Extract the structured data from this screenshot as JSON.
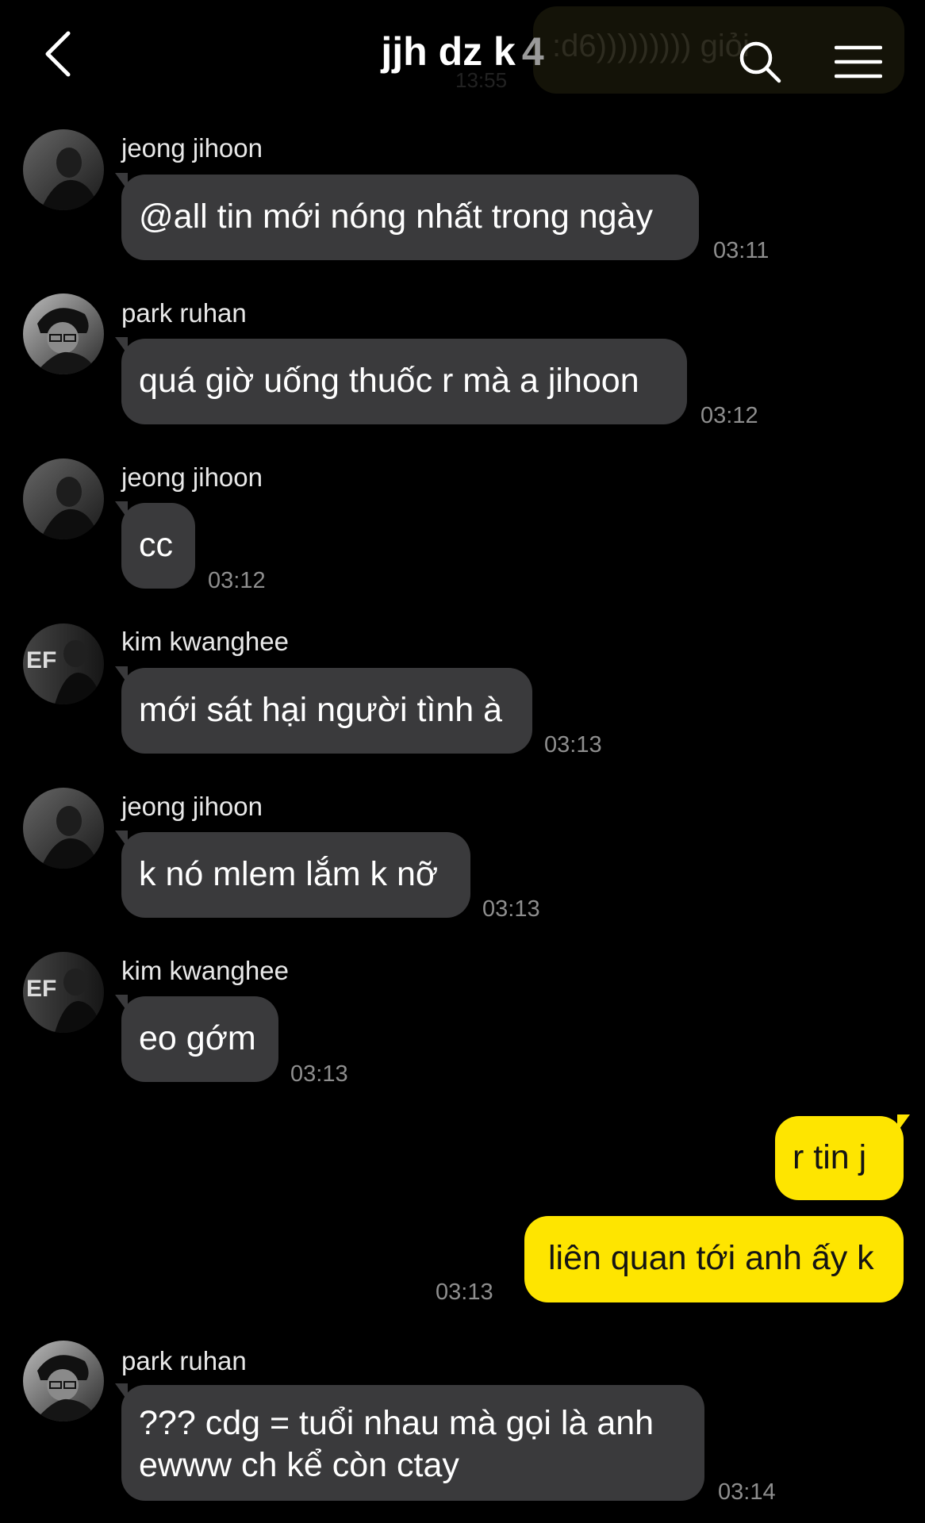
{
  "header": {
    "title": "jjh dz k",
    "member_count": "4",
    "icons": {
      "back": "back-arrow-icon",
      "search": "search-icon",
      "menu": "hamburger-menu-icon"
    },
    "behind_message": {
      "text": ":d6))))))))) giỏi",
      "time": "13:55"
    }
  },
  "colors": {
    "background": "#000000",
    "incoming_bubble": "#3a3a3c",
    "outgoing_bubble": "#fee500",
    "timestamp": "#8e8e8e"
  },
  "messages": [
    {
      "sender": "jeong jihoon",
      "text": "@all tin mới nóng nhất trong ngày",
      "time": "03:11",
      "direction": "incoming"
    },
    {
      "sender": "park ruhan",
      "text": "quá giờ uống thuốc r mà a jihoon",
      "time": "03:12",
      "direction": "incoming"
    },
    {
      "sender": "jeong jihoon",
      "text": "cc",
      "time": "03:12",
      "direction": "incoming"
    },
    {
      "sender": "kim kwanghee",
      "text": "mới sát hại người tình à",
      "time": "03:13",
      "direction": "incoming"
    },
    {
      "sender": "jeong jihoon",
      "text": "k nó mlem lắm k nỡ",
      "time": "03:13",
      "direction": "incoming"
    },
    {
      "sender": "kim kwanghee",
      "text": "eo gớm",
      "time": "03:13",
      "direction": "incoming"
    },
    {
      "text": "r tin j",
      "direction": "outgoing"
    },
    {
      "text": "liên quan tới anh ấy k",
      "time": "03:13",
      "direction": "outgoing"
    },
    {
      "sender": "park ruhan",
      "text_lines": [
        "??? cdg = tuổi nhau mà gọi là anh",
        "ewww ch kể còn ctay"
      ],
      "time": "03:14",
      "direction": "incoming"
    }
  ]
}
